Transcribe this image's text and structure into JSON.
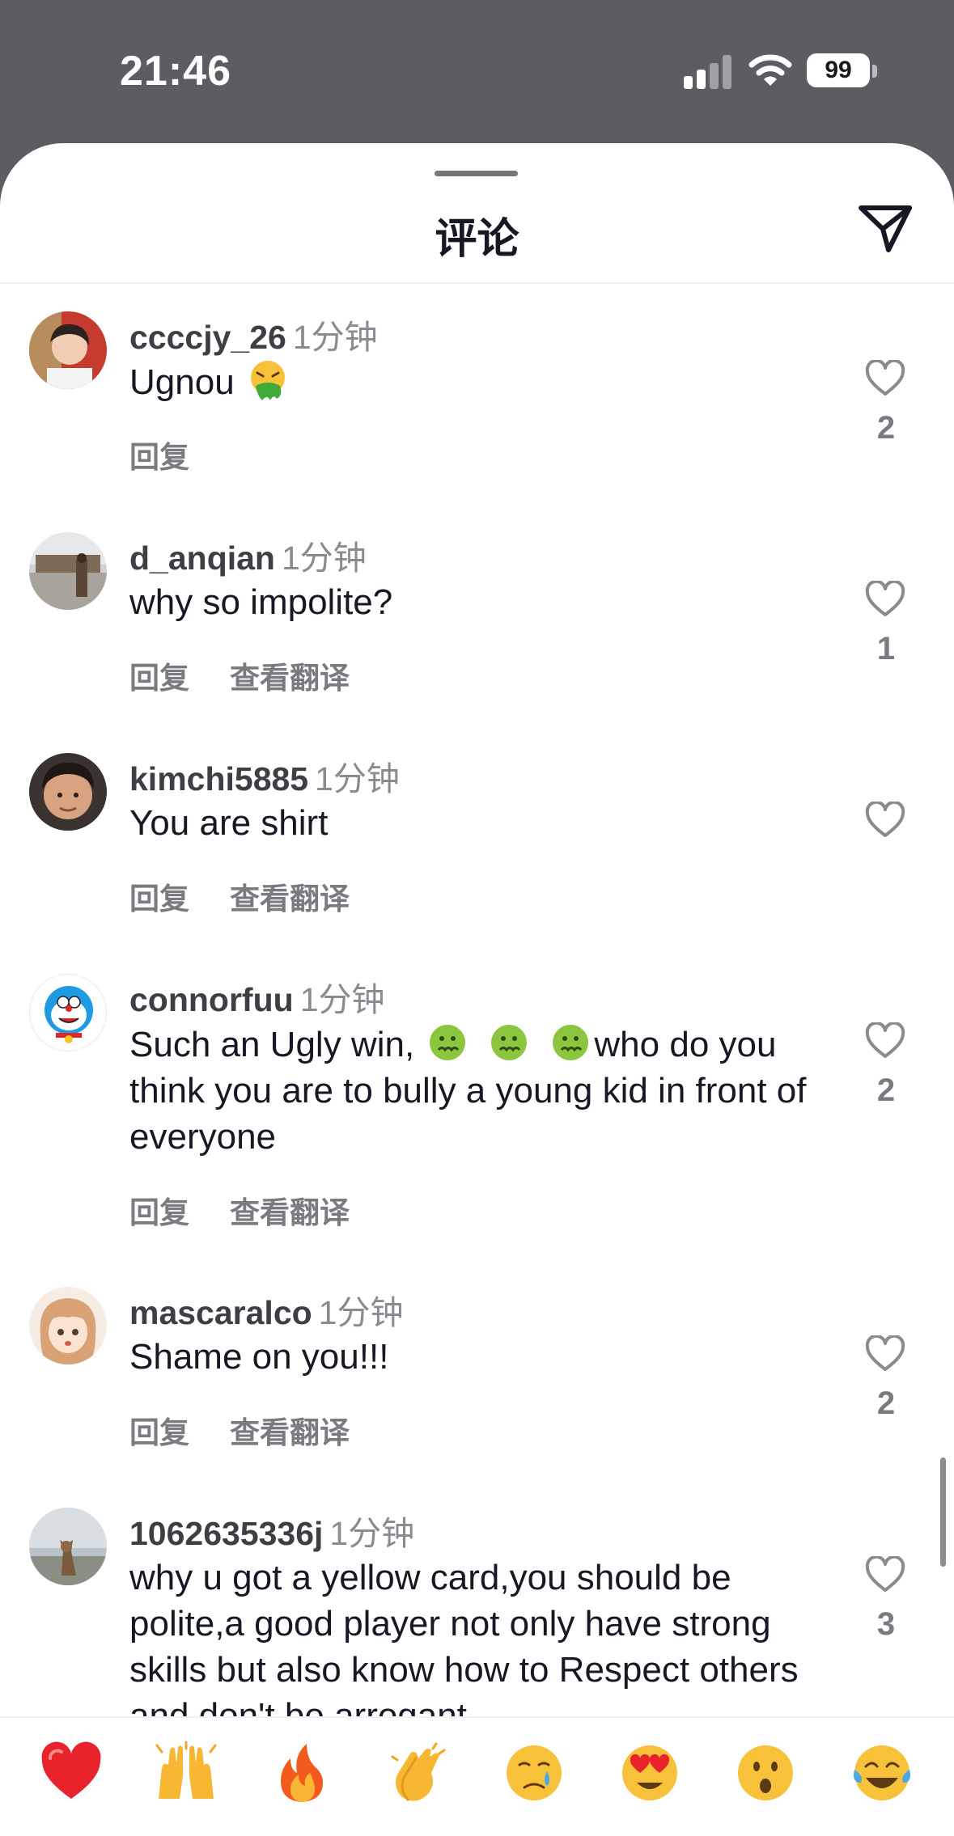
{
  "status_bar": {
    "time": "21:46",
    "battery": "99",
    "icons": [
      "signal-icon",
      "wifi-icon",
      "battery-icon"
    ]
  },
  "sheet": {
    "title": "评论",
    "send_icon": "send-icon"
  },
  "actions": {
    "reply": "回复",
    "translate": "查看翻译"
  },
  "comments": [
    {
      "user": "ccccjy_26",
      "time": "1分钟",
      "text_before": "Ugnou",
      "emojis": [
        "vomiting-face"
      ],
      "text_after": "",
      "likes": "2",
      "show_translate": false,
      "avatar": "person-photo-avatar"
    },
    {
      "user": "d_anqian",
      "time": "1分钟",
      "text_before": "why so impolite?",
      "emojis": [],
      "text_after": "",
      "likes": "1",
      "show_translate": true,
      "avatar": "street-photo-avatar"
    },
    {
      "user": "kimchi5885",
      "time": "1分钟",
      "text_before": "You are shirt",
      "emojis": [],
      "text_after": "",
      "likes": "",
      "show_translate": true,
      "avatar": "face-photo-avatar"
    },
    {
      "user": "connorfuu",
      "time": "1分钟",
      "text_before": "Such an Ugly win, ",
      "emojis": [
        "nauseated-face",
        "nauseated-face",
        "nauseated-face"
      ],
      "text_after": "who do you think you are to bully a young kid in front of everyone",
      "likes": "2",
      "show_translate": true,
      "avatar": "cartoon-robot-cat-avatar"
    },
    {
      "user": "mascaralco",
      "time": "1分钟",
      "text_before": "Shame on you!!!",
      "emojis": [],
      "text_after": "",
      "likes": "2",
      "show_translate": true,
      "avatar": "anime-girl-avatar"
    },
    {
      "user": "1062635336j",
      "time": "1分钟",
      "text_before": "why u got a yellow card,you should be polite,a good player not only have strong skills but also know how to Respect others and don't be arrogant",
      "emojis": [],
      "text_after": "",
      "likes": "3",
      "show_translate": false,
      "avatar": "cat-photo-avatar"
    }
  ],
  "emoji_bar": [
    "red-heart",
    "raising-hands",
    "fire",
    "clapping-hands",
    "crying-face",
    "heart-eyes-face",
    "surprised-face",
    "tears-of-joy-face"
  ],
  "colors": {
    "background": "#5b5d62",
    "sheet": "#ffffff",
    "text_primary": "#161823",
    "text_secondary": "#8a8b91"
  }
}
